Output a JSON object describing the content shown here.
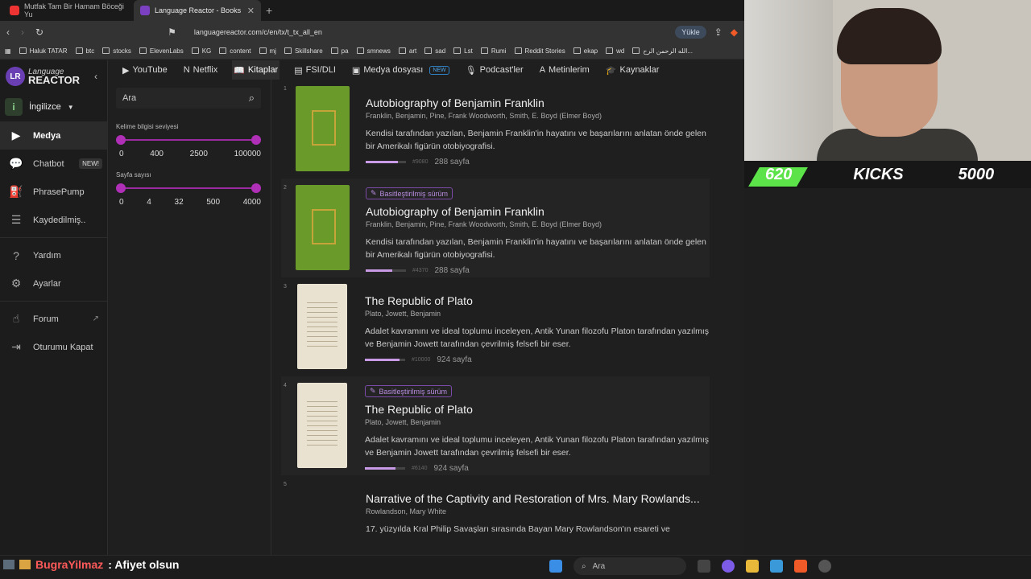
{
  "browser": {
    "tabs": [
      {
        "label": "Mutfak Tam Bir Hamam Böceği Yu",
        "fav_color": "#e33"
      },
      {
        "label": "Language Reactor - Books",
        "fav_color": "#7b3fc2"
      }
    ],
    "url": "languagereactor.com/c/en/tx/t_tx_all_en",
    "upload_label": "Yükle",
    "bookmarks": [
      "Haluk TATAR",
      "btc",
      "stocks",
      "ElevenLabs",
      "KG",
      "content",
      "mj",
      "Skillshare",
      "pa",
      "smnews",
      "art",
      "sad",
      "Lst",
      "Rumi",
      "Reddit Stories",
      "ekap",
      "wd",
      "الله الرحمن الرح..."
    ]
  },
  "sidebar": {
    "logo_top": "Language",
    "logo_bottom": "REACTOR",
    "logo_mark": "LR",
    "language": {
      "badge": "i",
      "label": "İngilizce"
    },
    "items": [
      {
        "label": "Medya",
        "icon": "▶"
      },
      {
        "label": "Chatbot",
        "icon": "💬",
        "badge": "NEW!"
      },
      {
        "label": "PhrasePump",
        "icon": "⛽"
      },
      {
        "label": "Kaydedilmiş..",
        "icon": "☰"
      },
      {
        "label": "Yardım",
        "icon": "?"
      },
      {
        "label": "Ayarlar",
        "icon": "⚙"
      },
      {
        "label": "Forum",
        "icon": "☝",
        "ext": "↗"
      },
      {
        "label": "Oturumu Kapat",
        "icon": "⇥"
      }
    ]
  },
  "topnav": [
    {
      "label": "YouTube",
      "icon": "▶"
    },
    {
      "label": "Netflix",
      "icon": "N"
    },
    {
      "label": "Kitaplar",
      "icon": "📖"
    },
    {
      "label": "FSI/DLI",
      "icon": "▤"
    },
    {
      "label": "Medya dosyası",
      "icon": "▣",
      "badge": "NEW"
    },
    {
      "label": "Podcast'ler",
      "icon": "🎙"
    },
    {
      "label": "Metinlerim",
      "icon": "A"
    },
    {
      "label": "Kaynaklar",
      "icon": "🎓"
    }
  ],
  "filters": {
    "search_placeholder": "Ara",
    "level_label": "Kelime bilgisi seviyesi",
    "level_ticks": [
      "0",
      "400",
      "2500",
      "100000"
    ],
    "pages_label": "Sayfa sayısı",
    "pages_ticks": [
      "0",
      "4",
      "32",
      "500",
      "4000"
    ]
  },
  "books": [
    {
      "num": "1",
      "simplified": "",
      "title": "Autobiography of Benjamin Franklin",
      "authors": "Franklin, Benjamin, Pine, Frank Woodworth, Smith, E. Boyd (Elmer Boyd)",
      "desc": "Kendisi tarafından yazılan, Benjamin Franklin'in hayatını ve başarılarını anlatan önde gelen bir Amerikalı figürün otobiyografisi.",
      "rank": "#9080",
      "pages": "288 sayfa",
      "progress": 0.8,
      "cover": "green"
    },
    {
      "num": "2",
      "simplified": "Basitleştirilmiş sürüm",
      "title": "Autobiography of Benjamin Franklin",
      "authors": "Franklin, Benjamin, Pine, Frank Woodworth, Smith, E. Boyd (Elmer Boyd)",
      "desc": "Kendisi tarafından yazılan, Benjamin Franklin'in hayatını ve başarılarını anlatan önde gelen bir Amerikalı figürün otobiyografisi.",
      "rank": "#4370",
      "pages": "288 sayfa",
      "progress": 0.65,
      "cover": "green"
    },
    {
      "num": "3",
      "simplified": "",
      "title": "The Republic of Plato",
      "authors": "Plato, Jowett, Benjamin",
      "desc": "Adalet kavramını ve ideal toplumu inceleyen, Antik Yunan filozofu Platon tarafından yazılmış ve Benjamin Jowett tarafından çevrilmiş felsefi bir eser.",
      "rank": "#10000",
      "pages": "924 sayfa",
      "progress": 0.85,
      "cover": "paper"
    },
    {
      "num": "4",
      "simplified": "Basitleştirilmiş sürüm",
      "title": "The Republic of Plato",
      "authors": "Plato, Jowett, Benjamin",
      "desc": "Adalet kavramını ve ideal toplumu inceleyen, Antik Yunan filozofu Platon tarafından yazılmış ve Benjamin Jowett tarafından çevrilmiş felsefi bir eser.",
      "rank": "#6140",
      "pages": "924 sayfa",
      "progress": 0.75,
      "cover": "paper"
    },
    {
      "num": "5",
      "simplified": "",
      "title": "Narrative of the Captivity and Restoration of Mrs. Mary Rowlands...",
      "authors": "Rowlandson, Mary White",
      "desc": "17. yüzyılda Kral Philip Savaşları sırasında Bayan Mary Rowlandson'ın esareti ve",
      "rank": "",
      "pages": "",
      "progress": 0,
      "cover": "none"
    }
  ],
  "overlay": {
    "counter_left": "620",
    "counter_label": "KICKS",
    "counter_right": "5000",
    "chat_user": "BugraYilmaz",
    "chat_message": ": Afiyet olsun",
    "taskbar_search": "Ara"
  }
}
